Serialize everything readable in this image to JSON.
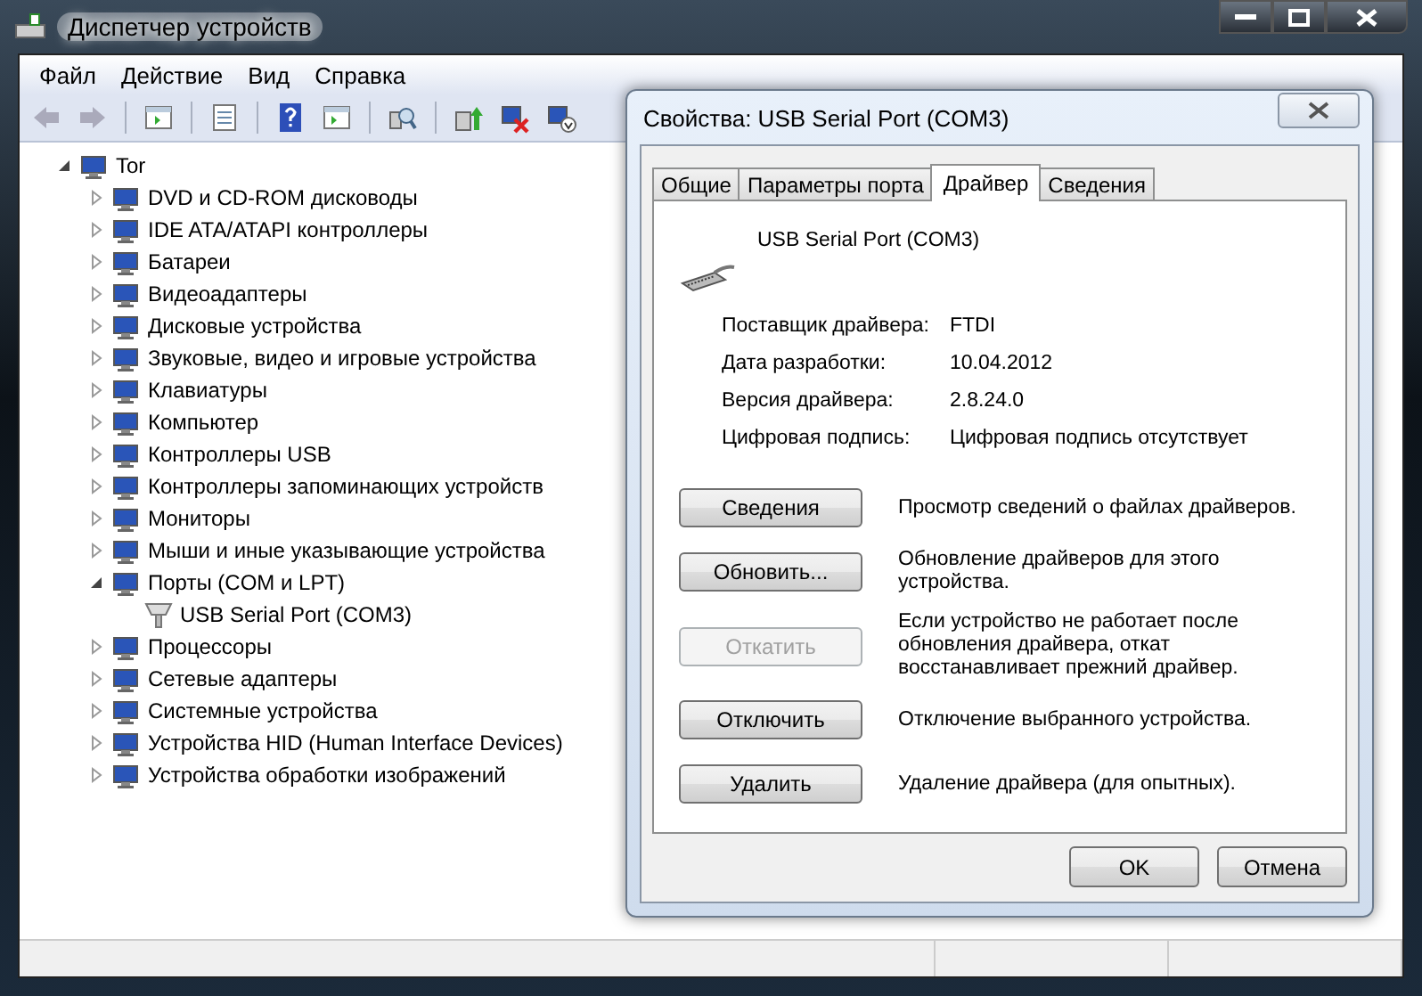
{
  "window": {
    "title": "Диспетчер устройств"
  },
  "menu": [
    "Файл",
    "Действие",
    "Вид",
    "Справка"
  ],
  "tree": {
    "label": "Tor",
    "expanded": true,
    "children": [
      {
        "label": "DVD и CD-ROM дисководы",
        "expanded": false
      },
      {
        "label": "IDE ATA/ATAPI контроллеры",
        "expanded": false
      },
      {
        "label": "Батареи",
        "expanded": false
      },
      {
        "label": "Видеоадаптеры",
        "expanded": false
      },
      {
        "label": "Дисковые устройства",
        "expanded": false
      },
      {
        "label": "Звуковые, видео и игровые устройства",
        "expanded": false
      },
      {
        "label": "Клавиатуры",
        "expanded": false
      },
      {
        "label": "Компьютер",
        "expanded": false
      },
      {
        "label": "Контроллеры USB",
        "expanded": false
      },
      {
        "label": "Контроллеры запоминающих устройств",
        "expanded": false
      },
      {
        "label": "Мониторы",
        "expanded": false
      },
      {
        "label": "Мыши и иные указывающие устройства",
        "expanded": false
      },
      {
        "label": "Порты (COM и LPT)",
        "expanded": true,
        "children": [
          {
            "label": "USB Serial Port (COM3)"
          }
        ]
      },
      {
        "label": "Процессоры",
        "expanded": false
      },
      {
        "label": "Сетевые адаптеры",
        "expanded": false
      },
      {
        "label": "Системные устройства",
        "expanded": false
      },
      {
        "label": "Устройства HID (Human Interface Devices)",
        "expanded": false
      },
      {
        "label": "Устройства обработки изображений",
        "expanded": false
      }
    ]
  },
  "dialog": {
    "title": "Свойства: USB Serial Port (COM3)",
    "tabs": [
      {
        "label": "Общие",
        "selected": false
      },
      {
        "label": "Параметры порта",
        "selected": false
      },
      {
        "label": "Драйвер",
        "selected": true
      },
      {
        "label": "Сведения",
        "selected": false
      }
    ],
    "device_name": "USB Serial Port (COM3)",
    "properties": [
      {
        "label": "Поставщик драйвера:",
        "value": "FTDI"
      },
      {
        "label": "Дата разработки:",
        "value": "10.04.2012"
      },
      {
        "label": "Версия драйвера:",
        "value": "2.8.24.0"
      },
      {
        "label": "Цифровая подпись:",
        "value": "Цифровая подпись отсутствует"
      }
    ],
    "actions": [
      {
        "label": "Сведения",
        "disabled": false,
        "description": "Просмотр сведений о файлах драйверов."
      },
      {
        "label": "Обновить...",
        "disabled": false,
        "description": "Обновление драйверов для этого устройства."
      },
      {
        "label": "Откатить",
        "disabled": true,
        "description": "Если устройство не работает после обновления драйвера, откат восстанавливает прежний драйвер."
      },
      {
        "label": "Отключить",
        "disabled": false,
        "description": "Отключение выбранного устройства."
      },
      {
        "label": "Удалить",
        "disabled": false,
        "description": "Удаление драйвера (для опытных)."
      }
    ],
    "buttons": [
      "OK",
      "Отмена"
    ]
  }
}
